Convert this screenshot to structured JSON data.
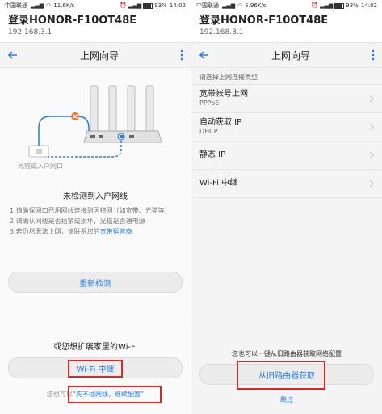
{
  "left": {
    "status": {
      "carrier": "中国联通",
      "speed": "11.6K/s",
      "battery": "93%",
      "time": "14:02"
    },
    "header": {
      "title": "登录HONOR-F10OT48E",
      "ip": "192.168.3.1"
    },
    "nav": {
      "title": "上网向导"
    },
    "illustration": {
      "modem_label": "光猫或入户网口"
    },
    "error_title": "未检测到入户网线",
    "tips": {
      "line1": "1.请确保网口已用网线连接到因特网（如宽带、光猫等）",
      "line2": "2.请确认网线是否插紧或损坏，光猫是否通电源",
      "line3_prefix": "3.若仍然无法上网，请联系您的",
      "line3_link": "宽带运营商"
    },
    "redetect_label": "重新检测",
    "expand_question": "或您想扩展家里的Wi-Fi",
    "wifi_relay_label": "Wi-Fi 中继",
    "hint_prefix": "您也可以",
    "hint_link": "“先不插网线，继续配置”"
  },
  "right": {
    "status": {
      "carrier": "中国联通",
      "speed": "5.96K/s",
      "battery": "93%",
      "time": "14:02"
    },
    "header": {
      "title": "登录HONOR-F10OT48E",
      "ip": "192.168.3.1"
    },
    "nav": {
      "title": "上网向导"
    },
    "section_header": "请选择上网连接类型",
    "options": [
      {
        "label": "宽带帐号上网",
        "sub": "PPPoE"
      },
      {
        "label": "自动获取 IP",
        "sub": "DHCP"
      },
      {
        "label": "静态 IP",
        "sub": ""
      },
      {
        "label": "Wi-Fi 中继",
        "sub": ""
      }
    ],
    "oneclick_text": "您也可以一键从旧路由器获取网络配置",
    "old_router_label": "从旧路由器获取",
    "skip_label": "跳过"
  },
  "colors": {
    "accent": "#2a7ae4",
    "highlight_box": "#d62a2a",
    "error_x": "#e8743b"
  }
}
